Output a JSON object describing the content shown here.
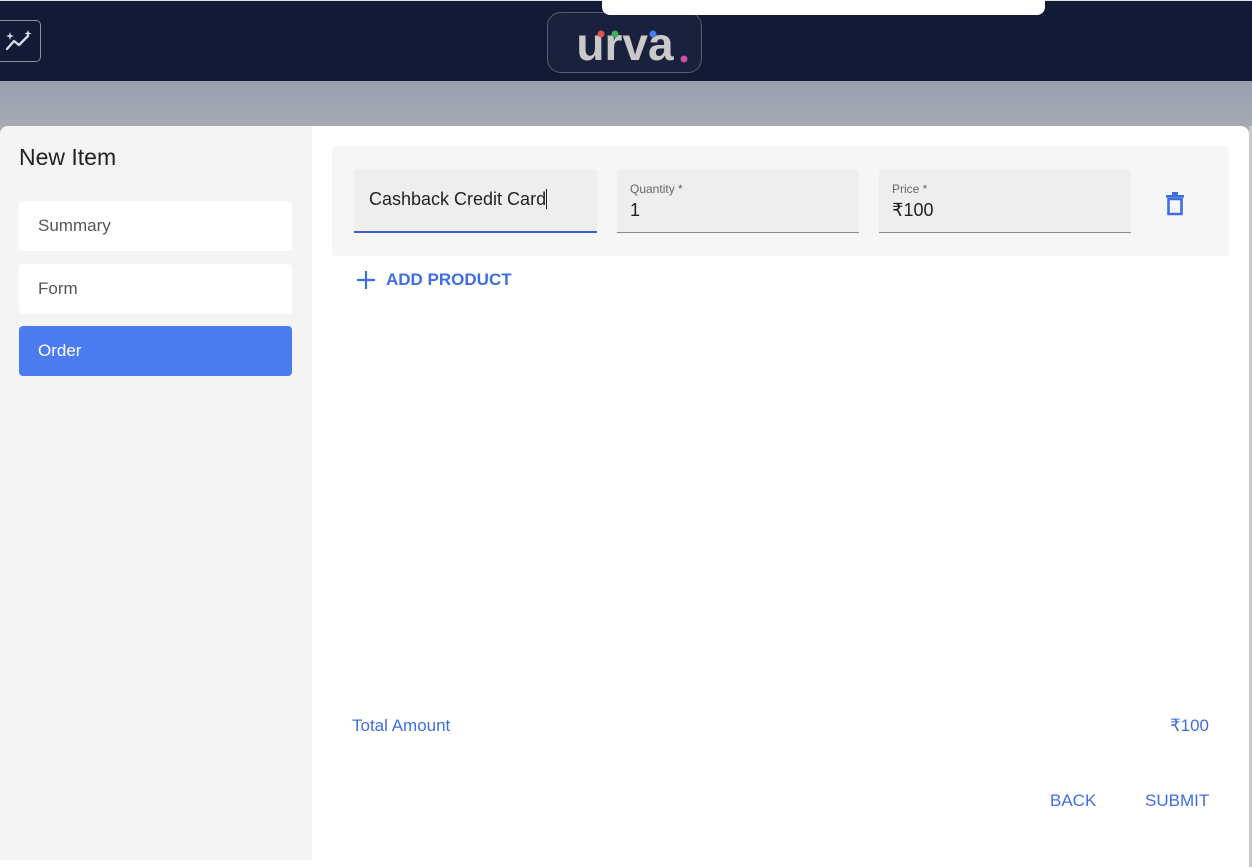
{
  "header": {
    "logo_text": "urva",
    "logo_color": "#c9c9c9",
    "logo_dot_colors": [
      "#e0554a",
      "#3fae55",
      "#4a7cf0",
      "#d14ea0"
    ],
    "sparkle_icon": "sparkle-chart-icon"
  },
  "dialog": {
    "title": "New Item",
    "nav": [
      {
        "label": "Summary",
        "active": false
      },
      {
        "label": "Form",
        "active": false
      },
      {
        "label": "Order",
        "active": true
      }
    ],
    "product": {
      "name_value": "Cashback Credit Card",
      "quantity_label": "Quantity *",
      "quantity_value": "1",
      "price_label": "Price *",
      "price_value": "₹100",
      "delete_icon": "trash-icon"
    },
    "add_product_label": "ADD PRODUCT",
    "total_label": "Total Amount",
    "total_value": "₹100",
    "back_label": "BACK",
    "submit_label": "SUBMIT",
    "accent_color": "#4a7cf0"
  }
}
